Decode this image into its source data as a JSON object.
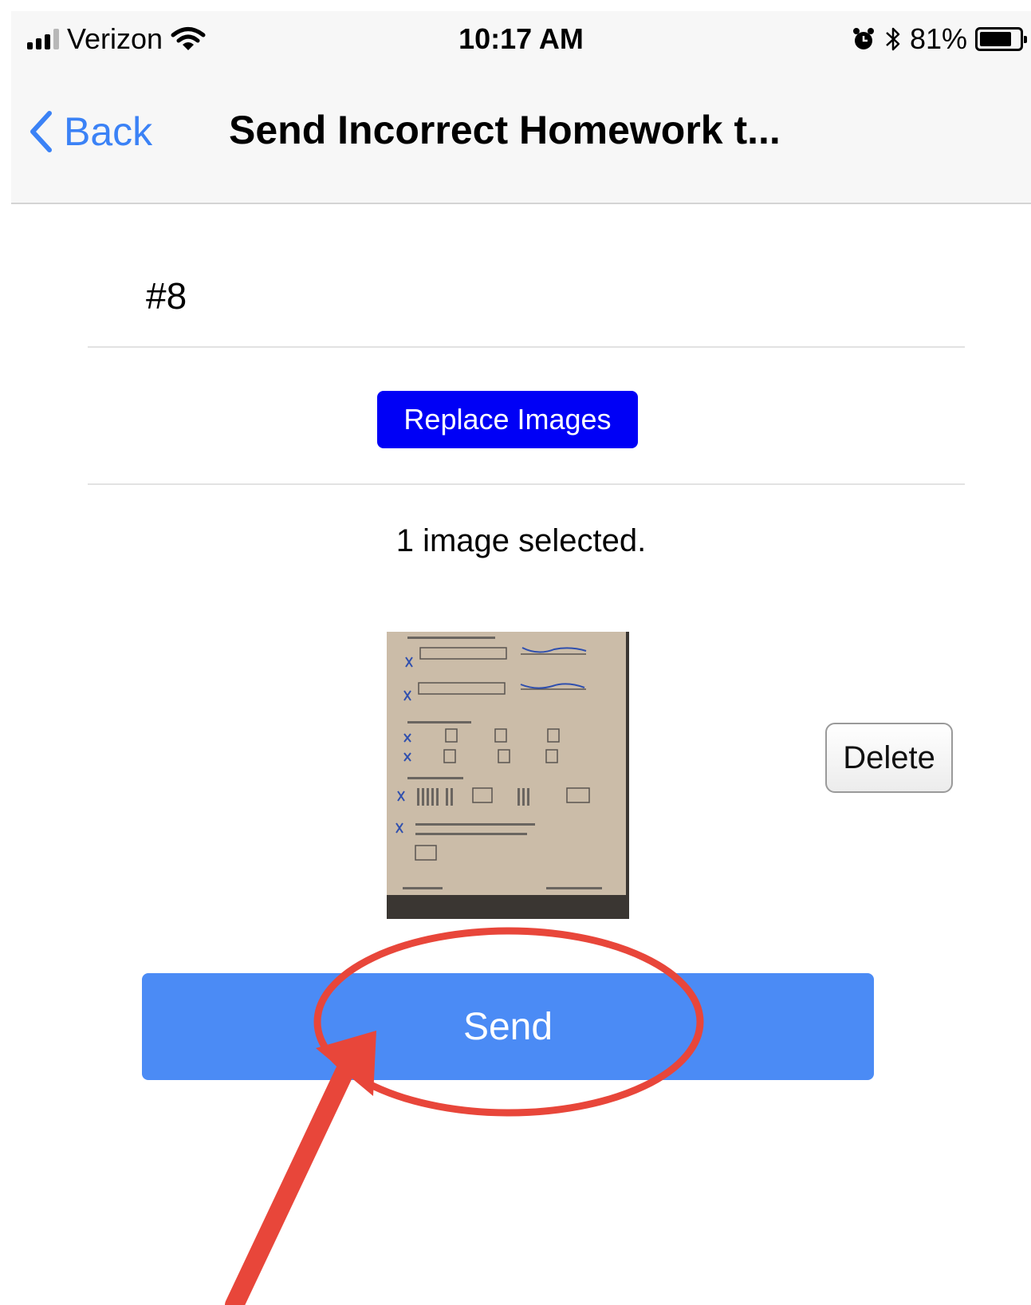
{
  "status_bar": {
    "carrier": "Verizon",
    "time": "10:17 AM",
    "battery_percent": "81%",
    "battery_level": 0.81,
    "icons": [
      "signal-icon",
      "wifi-icon",
      "alarm-icon",
      "bluetooth-icon",
      "battery-icon"
    ]
  },
  "nav": {
    "back_label": "Back",
    "title": "Send Incorrect Homework t..."
  },
  "form": {
    "item_number": "#8",
    "replace_label": "Replace Images",
    "selection_text": "1 image selected.",
    "delete_label": "Delete",
    "send_label": "Send"
  },
  "colors": {
    "ios_blue": "#3b82f6",
    "replace_button": "#0000f6",
    "send_button": "#4b8bf5",
    "annotation": "#e8463a"
  }
}
